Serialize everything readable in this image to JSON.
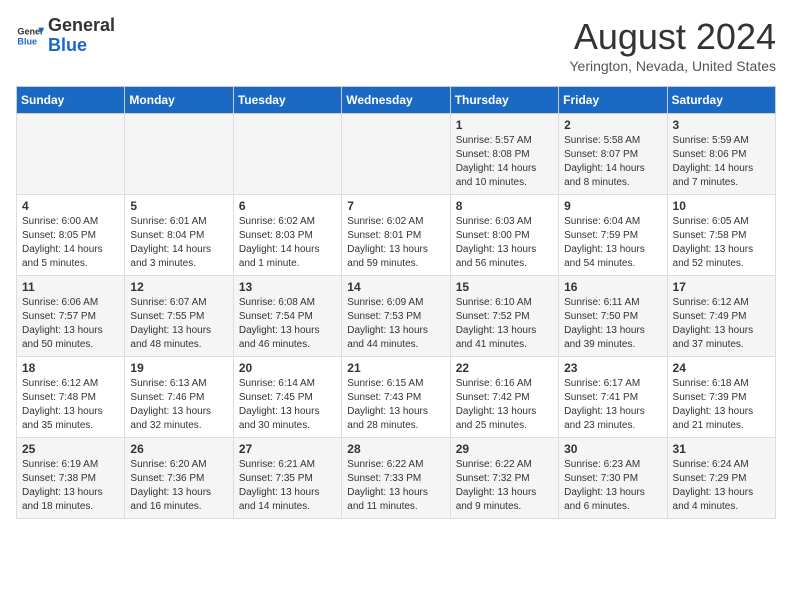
{
  "header": {
    "logo_general": "General",
    "logo_blue": "Blue",
    "title": "August 2024",
    "subtitle": "Yerington, Nevada, United States"
  },
  "days_of_week": [
    "Sunday",
    "Monday",
    "Tuesday",
    "Wednesday",
    "Thursday",
    "Friday",
    "Saturday"
  ],
  "weeks": [
    [
      {
        "day": "",
        "info": ""
      },
      {
        "day": "",
        "info": ""
      },
      {
        "day": "",
        "info": ""
      },
      {
        "day": "",
        "info": ""
      },
      {
        "day": "1",
        "info": "Sunrise: 5:57 AM\nSunset: 8:08 PM\nDaylight: 14 hours\nand 10 minutes."
      },
      {
        "day": "2",
        "info": "Sunrise: 5:58 AM\nSunset: 8:07 PM\nDaylight: 14 hours\nand 8 minutes."
      },
      {
        "day": "3",
        "info": "Sunrise: 5:59 AM\nSunset: 8:06 PM\nDaylight: 14 hours\nand 7 minutes."
      }
    ],
    [
      {
        "day": "4",
        "info": "Sunrise: 6:00 AM\nSunset: 8:05 PM\nDaylight: 14 hours\nand 5 minutes."
      },
      {
        "day": "5",
        "info": "Sunrise: 6:01 AM\nSunset: 8:04 PM\nDaylight: 14 hours\nand 3 minutes."
      },
      {
        "day": "6",
        "info": "Sunrise: 6:02 AM\nSunset: 8:03 PM\nDaylight: 14 hours\nand 1 minute."
      },
      {
        "day": "7",
        "info": "Sunrise: 6:02 AM\nSunset: 8:01 PM\nDaylight: 13 hours\nand 59 minutes."
      },
      {
        "day": "8",
        "info": "Sunrise: 6:03 AM\nSunset: 8:00 PM\nDaylight: 13 hours\nand 56 minutes."
      },
      {
        "day": "9",
        "info": "Sunrise: 6:04 AM\nSunset: 7:59 PM\nDaylight: 13 hours\nand 54 minutes."
      },
      {
        "day": "10",
        "info": "Sunrise: 6:05 AM\nSunset: 7:58 PM\nDaylight: 13 hours\nand 52 minutes."
      }
    ],
    [
      {
        "day": "11",
        "info": "Sunrise: 6:06 AM\nSunset: 7:57 PM\nDaylight: 13 hours\nand 50 minutes."
      },
      {
        "day": "12",
        "info": "Sunrise: 6:07 AM\nSunset: 7:55 PM\nDaylight: 13 hours\nand 48 minutes."
      },
      {
        "day": "13",
        "info": "Sunrise: 6:08 AM\nSunset: 7:54 PM\nDaylight: 13 hours\nand 46 minutes."
      },
      {
        "day": "14",
        "info": "Sunrise: 6:09 AM\nSunset: 7:53 PM\nDaylight: 13 hours\nand 44 minutes."
      },
      {
        "day": "15",
        "info": "Sunrise: 6:10 AM\nSunset: 7:52 PM\nDaylight: 13 hours\nand 41 minutes."
      },
      {
        "day": "16",
        "info": "Sunrise: 6:11 AM\nSunset: 7:50 PM\nDaylight: 13 hours\nand 39 minutes."
      },
      {
        "day": "17",
        "info": "Sunrise: 6:12 AM\nSunset: 7:49 PM\nDaylight: 13 hours\nand 37 minutes."
      }
    ],
    [
      {
        "day": "18",
        "info": "Sunrise: 6:12 AM\nSunset: 7:48 PM\nDaylight: 13 hours\nand 35 minutes."
      },
      {
        "day": "19",
        "info": "Sunrise: 6:13 AM\nSunset: 7:46 PM\nDaylight: 13 hours\nand 32 minutes."
      },
      {
        "day": "20",
        "info": "Sunrise: 6:14 AM\nSunset: 7:45 PM\nDaylight: 13 hours\nand 30 minutes."
      },
      {
        "day": "21",
        "info": "Sunrise: 6:15 AM\nSunset: 7:43 PM\nDaylight: 13 hours\nand 28 minutes."
      },
      {
        "day": "22",
        "info": "Sunrise: 6:16 AM\nSunset: 7:42 PM\nDaylight: 13 hours\nand 25 minutes."
      },
      {
        "day": "23",
        "info": "Sunrise: 6:17 AM\nSunset: 7:41 PM\nDaylight: 13 hours\nand 23 minutes."
      },
      {
        "day": "24",
        "info": "Sunrise: 6:18 AM\nSunset: 7:39 PM\nDaylight: 13 hours\nand 21 minutes."
      }
    ],
    [
      {
        "day": "25",
        "info": "Sunrise: 6:19 AM\nSunset: 7:38 PM\nDaylight: 13 hours\nand 18 minutes."
      },
      {
        "day": "26",
        "info": "Sunrise: 6:20 AM\nSunset: 7:36 PM\nDaylight: 13 hours\nand 16 minutes."
      },
      {
        "day": "27",
        "info": "Sunrise: 6:21 AM\nSunset: 7:35 PM\nDaylight: 13 hours\nand 14 minutes."
      },
      {
        "day": "28",
        "info": "Sunrise: 6:22 AM\nSunset: 7:33 PM\nDaylight: 13 hours\nand 11 minutes."
      },
      {
        "day": "29",
        "info": "Sunrise: 6:22 AM\nSunset: 7:32 PM\nDaylight: 13 hours\nand 9 minutes."
      },
      {
        "day": "30",
        "info": "Sunrise: 6:23 AM\nSunset: 7:30 PM\nDaylight: 13 hours\nand 6 minutes."
      },
      {
        "day": "31",
        "info": "Sunrise: 6:24 AM\nSunset: 7:29 PM\nDaylight: 13 hours\nand 4 minutes."
      }
    ]
  ]
}
